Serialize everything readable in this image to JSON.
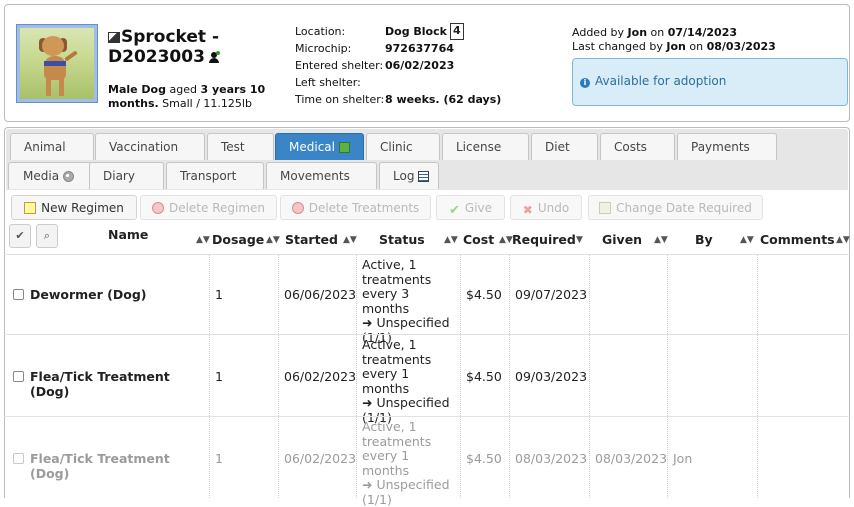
{
  "animal": {
    "name": "Sprocket - D2023003",
    "summary_sex_species": "Male Dog",
    "summary_aged": "aged",
    "summary_age_value": "3 years 10 months.",
    "summary_size_weight": "Small / 11.125lb"
  },
  "details": {
    "location_label": "Location:",
    "location_value": "Dog Block",
    "location_unit": "4",
    "microchip_label": "Microchip:",
    "microchip_value": "972637764",
    "entered_label": "Entered shelter:",
    "entered_value": "06/02/2023",
    "left_label": "Left shelter:",
    "left_value": "",
    "time_label": "Time on shelter:",
    "time_value": "8 weeks. (62 days)"
  },
  "audit": {
    "added_prefix": "Added by",
    "added_by": "Jon",
    "added_on_word": "on",
    "added_date": "07/14/2023",
    "changed_prefix": "Last changed by",
    "changed_by": "Jon",
    "changed_on_word": "on",
    "changed_date": "08/03/2023"
  },
  "status_message": "Available for adoption",
  "tabs": [
    {
      "label": "Animal"
    },
    {
      "label": "Vaccination"
    },
    {
      "label": "Test"
    },
    {
      "label": "Medical"
    },
    {
      "label": "Clinic"
    },
    {
      "label": "License"
    },
    {
      "label": "Diet"
    },
    {
      "label": "Costs"
    },
    {
      "label": "Payments"
    },
    {
      "label": "Media"
    },
    {
      "label": "Diary"
    },
    {
      "label": "Transport"
    },
    {
      "label": "Movements"
    },
    {
      "label": "Log"
    }
  ],
  "toolbar": {
    "new_regimen": "New Regimen",
    "delete_regimen": "Delete Regimen",
    "delete_treatments": "Delete Treatments",
    "give": "Give",
    "undo": "Undo",
    "change_date": "Change Date Required"
  },
  "columns": {
    "name": "Name",
    "dosage": "Dosage",
    "started": "Started",
    "status": "Status",
    "cost": "Cost",
    "required": "Required",
    "given": "Given",
    "by": "By",
    "comments": "Comments"
  },
  "rows": [
    {
      "name": "Dewormer (Dog)",
      "dosage": "1",
      "started": "06/06/2023",
      "status_l1": "Active, 1",
      "status_l2": "treatments",
      "status_l3": "every 3 months",
      "status_l4": "➜ Unspecified",
      "status_l5": "(1/1)",
      "cost": "$4.50",
      "required": "09/07/2023",
      "given": "",
      "by": "",
      "comments": ""
    },
    {
      "name": "Flea/Tick Treatment (Dog)",
      "dosage": "1",
      "started": "06/02/2023",
      "status_l1": "Active, 1",
      "status_l2": "treatments",
      "status_l3": "every 1 months",
      "status_l4": "➜ Unspecified",
      "status_l5": "(1/1)",
      "cost": "$4.50",
      "required": "09/03/2023",
      "given": "",
      "by": "",
      "comments": ""
    },
    {
      "name": "Flea/Tick Treatment (Dog)",
      "dosage": "1",
      "started": "06/02/2023",
      "status_l1": "Active, 1",
      "status_l2": "treatments",
      "status_l3": "every 1 months",
      "status_l4": "➜ Unspecified",
      "status_l5": "(1/1)",
      "cost": "$4.50",
      "required": "08/03/2023",
      "given": "08/03/2023",
      "by": "Jon",
      "comments": ""
    }
  ]
}
